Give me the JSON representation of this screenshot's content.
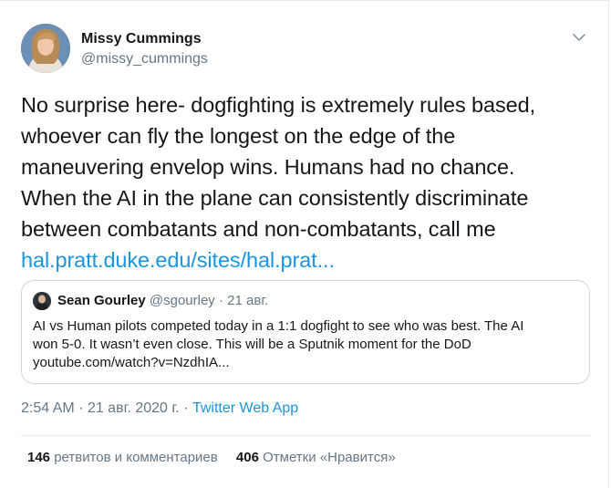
{
  "author": {
    "name": "Missy Cummings",
    "handle": "@missy_cummings"
  },
  "tweet": {
    "lines": [
      "No surprise here- dogfighting is extremely rules based,",
      "whoever can fly the longest on the edge of the",
      "maneuvering envelop wins. Humans had no chance.",
      "When the AI in the plane can consistently discriminate",
      "between combatants and non-combatants, call me"
    ],
    "link_text": "hal.pratt.duke.edu/sites/hal.prat..."
  },
  "quote": {
    "name": "Sean Gourley",
    "handle": "@sgourley",
    "separator": "·",
    "date": "21 авг.",
    "lines": [
      "AI vs Human pilots competed today in a 1:1 dogfight to see who was best. The AI",
      "won 5-0. It wasn’t even close. This will be a Sputnik moment for the DoD",
      "youtube.com/watch?v=NzdhIA..."
    ]
  },
  "meta": {
    "time": "2:54 AM",
    "date": "21 авг. 2020 г.",
    "separator": "·",
    "app": "Twitter Web App"
  },
  "stats": {
    "retweets_count": "146",
    "retweets_label": "ретвитов и комментариев",
    "likes_count": "406",
    "likes_label": "Отметки «Нравится»"
  },
  "icons": {
    "caret": "chevron-down-icon",
    "avatar": "user-avatar",
    "quote_avatar": "quoted-user-avatar"
  },
  "colors": {
    "link": "#1b95e0",
    "secondary_text": "#657786",
    "border": "#ccd6dd"
  }
}
